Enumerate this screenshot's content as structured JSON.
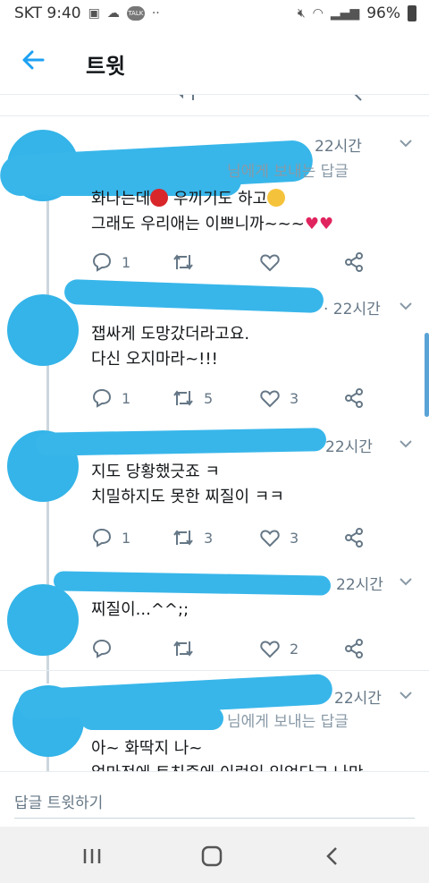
{
  "status_bar": {
    "carrier_time": "SKT 9:40",
    "battery": "96%",
    "talk_badge": "TALK"
  },
  "header": {
    "title": "트윗"
  },
  "tweets": [
    {
      "replying_to": "님에게 보내는 답글",
      "time": "22시간",
      "lines": [
        "화나는데",
        "우끼기도 하고",
        "그래도 우리애는 이쁘니까~~~"
      ],
      "replies": "1",
      "retweets": "",
      "likes": ""
    },
    {
      "time": "· 22시간",
      "lines": [
        "잽싸게 도망갔더라고요.",
        "다신 오지마라~!!!"
      ],
      "replies": "1",
      "retweets": "5",
      "likes": "3"
    },
    {
      "time": "22시간",
      "lines": [
        "지도 당황했긋죠 ㅋ",
        "치밀하지도 못한 찌질이 ㅋㅋ"
      ],
      "replies": "1",
      "retweets": "3",
      "likes": "3"
    },
    {
      "time": "22시간",
      "lines": [
        "찌질이...^^;;"
      ],
      "replies": "",
      "retweets": "",
      "likes": "2"
    },
    {
      "replying_to": "님에게 보내는 답글",
      "time": "22시간",
      "lines": [
        "아~ 화딱지 나~",
        "얼마전에 트친중에 이런일 있었다고 나만"
      ]
    }
  ],
  "reply_box": {
    "placeholder": "답글 트윗하기"
  },
  "colors": {
    "accent": "#1da1f2",
    "scribble": "#38b6ea",
    "like_heart": "#e0245e"
  }
}
